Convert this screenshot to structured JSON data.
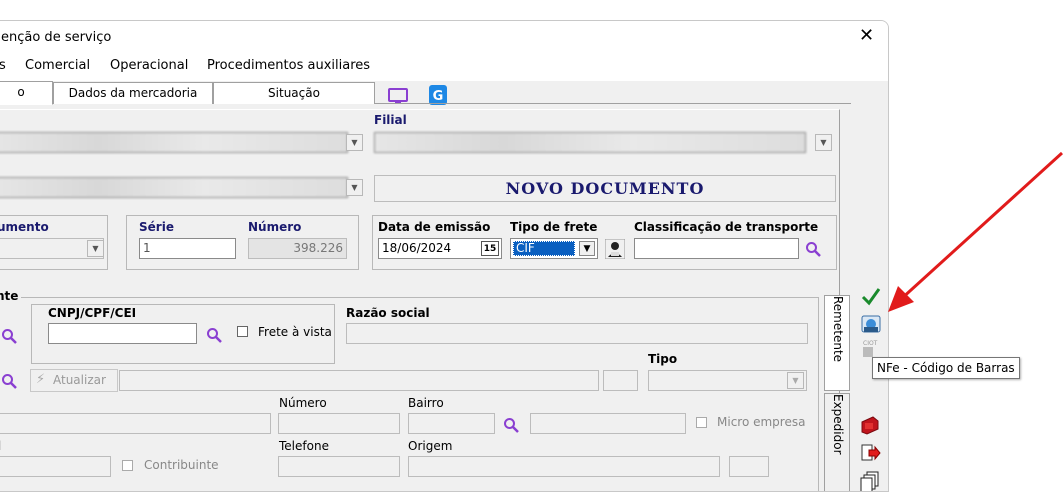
{
  "window": {
    "title": "enção de serviço",
    "close_glyph": "✕"
  },
  "menu": {
    "items": [
      "s",
      "Comercial",
      "Operacional",
      "Procedimentos auxiliares"
    ]
  },
  "tabs": [
    "o",
    "Dados da mercadoria",
    "Situação"
  ],
  "filial": {
    "label": "Filial"
  },
  "novo_documento": "NOVO DOCUMENTO",
  "documento": {
    "tipo_label": "umento",
    "serie_label": "Série",
    "serie_value": "1",
    "numero_label": "Número",
    "numero_value": "398.226"
  },
  "emissao": {
    "data_label": "Data de emissão",
    "data_value": "18/06/2024",
    "calendar_text": "15",
    "frete_label": "Tipo de frete",
    "frete_value": "CIF",
    "classificacao_label": "Classificação de transporte"
  },
  "remetente": {
    "group_label": "nte",
    "cnpj_label": "CNPJ/CPF/CEI",
    "frete_a_vista_label": "Frete à vista",
    "razao_social_label": "Razão social",
    "atualizar_label": "Atualizar",
    "tipo_label": "Tipo",
    "numero_label": "Número",
    "bairro_label": "Bairro",
    "micro_empresa_label": "Micro empresa",
    "l_label": "l",
    "telefone_label": "Telefone",
    "origem_label": "Origem",
    "contribuinte_label": "Contribuinte"
  },
  "side_tabs": [
    "Remetente",
    "Expedidor"
  ],
  "toolbar": {
    "ciot_label": "CIOT"
  },
  "tooltip": "NFe - Código de Barras",
  "colors": {
    "accent_purple": "#8a3fd1",
    "arrow_red": "#e11b1b",
    "title_blue": "#1a1a6e",
    "ok_green": "#1a8a2c"
  }
}
